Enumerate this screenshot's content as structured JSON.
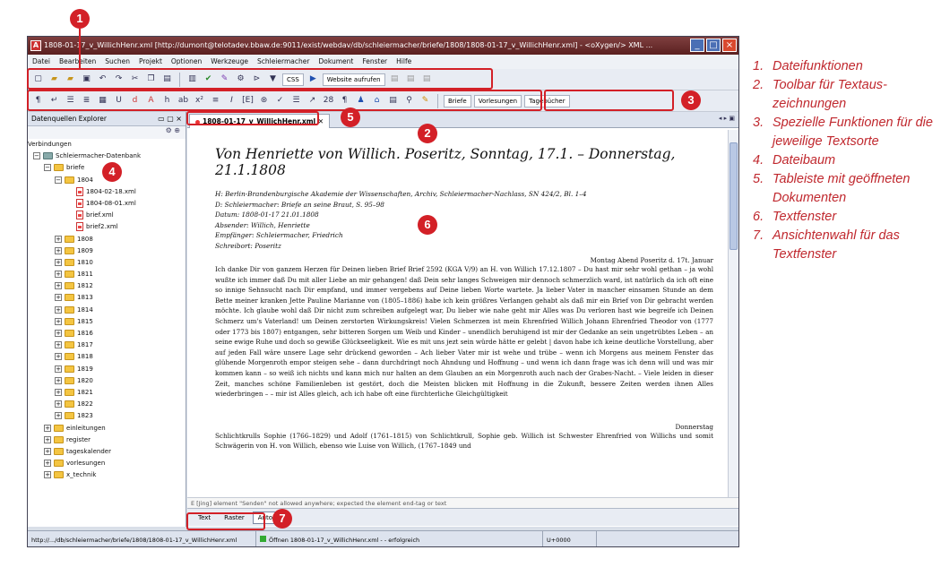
{
  "window": {
    "title": "1808-01-17_v_WillichHenr.xml [http://dumont@telotadev.bbaw.de:9011/exist/webdav/db/schleiermacher/briefe/1808/1808-01-17_v_WillichHenr.xml] - <oXygen/> XML ..."
  },
  "menu": [
    "Datei",
    "Bearbeiten",
    "Suchen",
    "Projekt",
    "Optionen",
    "Werkzeuge",
    "Schleiermacher",
    "Dokument",
    "Fenster",
    "Hilfe"
  ],
  "toolbar1": {
    "css_label": "CSS",
    "website_label": "Website aufrufen"
  },
  "toolbar3": {
    "briefe_label": "Briefe",
    "vorlesungen_label": "Vorlesungen",
    "tagebuecher_label": "Tagebücher"
  },
  "left_panel": {
    "title": "Datenquellen Explorer",
    "connections_label": "Verbindungen",
    "tree": {
      "db": "Schleiermacher-Datenbank",
      "briefe": "briefe",
      "year_open": "1804",
      "files": [
        "1804-02-18.xml",
        "1804-08-01.xml",
        "brief.xml",
        "brief2.xml"
      ],
      "years": [
        "1808",
        "1809",
        "1810",
        "1811",
        "1812",
        "1813",
        "1814",
        "1815",
        "1816",
        "1817",
        "1818",
        "1819",
        "1820",
        "1821",
        "1822",
        "1823"
      ],
      "other": [
        "einleitungen",
        "register",
        "tageskalender",
        "vorlesungen",
        "x_technik"
      ]
    }
  },
  "editor": {
    "tab_label": "1808-01-17_v_WillichHenr.xml",
    "heading": "Von Henriette von Willich. Poseritz, Sonntag, 17.1. – Donnerstag, 21.1.1808",
    "meta": [
      "H: Berlin-Brandenburgische Akademie der Wissenschaften, Archiv, Schleiermacher-Nachlass, SN 424/2, Bl. 1–4",
      "D: Schleiermacher: Briefe an seine Braut, S. 95–98",
      "Datum: 1808-01-17 21.01.1808",
      "Absender: Willich, Henriette",
      "Empfänger: Schleiermacher, Friedrich",
      "Schreibort: Poseritz"
    ],
    "date_line": "Montag Abend Poseritz d. 17t. Januar",
    "paragraph": "Ich danke Dir von ganzem Herzen für Deinen lieben Brief Brief 2592 (KGA V/9) an H. von Willich 17.12.1807 – Du hast mir sehr wohl gethan – ja wohl wußte ich immer daß Du mit aller Liebe an mir gehangen! daß Dein sehr langes Schweigen mir dennoch schmerzlich ward, ist natürlich da ich oft eine so innige Sehnsucht nach Dir empfand, und immer vergebens auf Deine lieben Worte wartete. Ja lieber Vater in mancher einsamen Stunde an dem Bette meiner kranken Jette Pauline Marianne von (1805–1886) habe ich kein größres Verlangen gehabt als daß mir ein Brief von Dir gebracht werden möchte. Ich glaube wohl daß Dir nicht zum schreiben aufgelegt war, Du lieber wie nahe geht mir Alles was Du verloren hast wie begreife ich Deinen Schmerz um's Vaterland! um Deinen zerstorten Wirkungskreis! Vielen Schmerzen ist mein Ehrenfried Willich Johann Ehrenfried Theodor von (1777 oder 1773 bis 1807) entgangen, sehr bitteren Sorgen um Weib und Kinder – unendlich beruhigend ist mir der Gedanke an sein ungetrübtes Leben – an seine ewige Ruhe und doch so gewiße Glückseeligkeit. Wie es mit uns jezt sein würde hätte er gelebt | davon habe ich keine deutliche Vorstellung, aber auf jeden Fall wäre unsere Lage sehr drückend geworden – Ach lieber Vater mir ist wehe und trübe – wenn ich Morgens aus meinem Fenster das glühende Morgenroth empor steigen sehe – dann durchdringt noch Ahndung und Hoffnung – und wenn ich dann frage was ich denn will und was mir kommen kann – so weiß ich nichts und kann mich nur halten an dem Glauben an ein Morgenroth auch nach der Grabes-Nacht. – Viele leiden in dieser Zeit, manches schöne Familienleben ist gestört, doch die Meisten blicken mit Hoffnung in die Zukunft, bessere Zeiten werden ihnen Alles wiederbringen – – mir ist Alles gleich, ach ich habe oft eine fürchterliche Gleichgültigkeit",
    "date_line2": "Donnerstag",
    "paragraph2": "Schlichtkrulls Sophie (1766–1829) und Adolf (1761–1815) von Schlichtkrull, Sophie geb. Willich ist Schwester Ehrenfried von Willichs und somit Schwägerin von H. von Willich, ebenso wie Luise von Willich, (1767–1849 und",
    "status_message": "E [Jing] element \"Senden\" not allowed anywhere; expected the element end-tag or text",
    "modes": [
      "Text",
      "Raster",
      "Autor"
    ],
    "active_mode": "Autor"
  },
  "statusbar": {
    "path": "http://.../db/schleiermacher/briefe/1808/1808-01-17_v_WillichHenr.xml",
    "message": "Öffnen 1808-01-17_v_WillichHenr.xml - - erfolgreich",
    "encoding": "U+0000"
  },
  "callouts": [
    "1",
    "2",
    "3",
    "4",
    "5",
    "6",
    "7"
  ],
  "legend": [
    {
      "num": "1.",
      "text": "Dateifunktionen"
    },
    {
      "num": "2.",
      "text": "Toolbar für Textaus­zeichnungen"
    },
    {
      "num": "3.",
      "text": "Spezielle Funktionen für die jeweilige Textsorte"
    },
    {
      "num": "4.",
      "text": "Dateibaum"
    },
    {
      "num": "5.",
      "text": "Tableiste mit geöffne­ten Dokumenten"
    },
    {
      "num": "6.",
      "text": "Textfenster"
    },
    {
      "num": "7.",
      "text": "Ansichtenwahl für das Textfenster"
    }
  ],
  "colors": {
    "accent": "#d32027",
    "legend_text": "#c0282e"
  }
}
